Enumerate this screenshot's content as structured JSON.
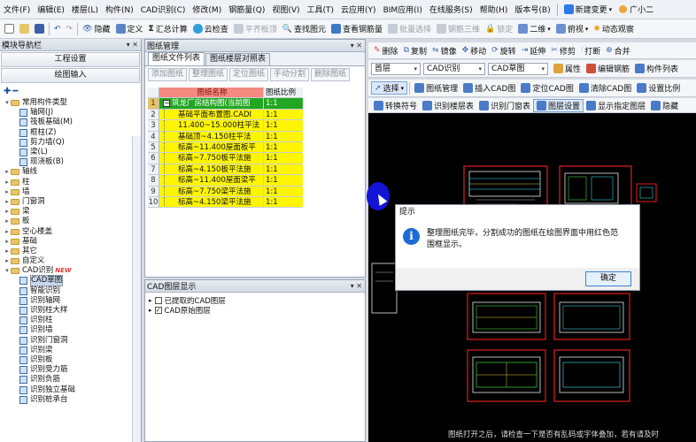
{
  "menubar": {
    "items": [
      "文件(F)",
      "编辑(E)",
      "楼层(L)",
      "构件(N)",
      "CAD识别(C)",
      "修改(M)",
      "钢筋量(Q)",
      "视图(V)",
      "工具(T)",
      "云应用(Y)",
      "BIM应用(I)",
      "在线服务(S)",
      "帮助(H)",
      "版本号(B)"
    ],
    "new_change": "新建变更",
    "user": "广小二"
  },
  "toolbar1": {
    "items": [
      "隐藏",
      "定义",
      "汇总计算",
      "云检查",
      "平齐板顶",
      "查找图元",
      "查看钢筋量",
      "批量选择",
      "钢筋三维",
      "锁定",
      "二维",
      "俯视",
      "动态观察"
    ]
  },
  "left_panel": {
    "title": "模块导航栏",
    "buttons": [
      "工程设置",
      "绘图输入"
    ],
    "tree": [
      {
        "label": "常用构件类型",
        "level": 0,
        "type": "folder",
        "exp": "▾"
      },
      {
        "label": "轴网(J)",
        "level": 1,
        "type": "leaf"
      },
      {
        "label": "筏板基础(M)",
        "level": 1,
        "type": "leaf"
      },
      {
        "label": "框柱(Z)",
        "level": 1,
        "type": "leaf"
      },
      {
        "label": "剪力墙(Q)",
        "level": 1,
        "type": "leaf"
      },
      {
        "label": "梁(L)",
        "level": 1,
        "type": "leaf"
      },
      {
        "label": "现浇板(B)",
        "level": 1,
        "type": "leaf"
      },
      {
        "label": "轴线",
        "level": 0,
        "type": "folder",
        "exp": "▸"
      },
      {
        "label": "柱",
        "level": 0,
        "type": "folder",
        "exp": "▸"
      },
      {
        "label": "墙",
        "level": 0,
        "type": "folder",
        "exp": "▸"
      },
      {
        "label": "门窗洞",
        "level": 0,
        "type": "folder",
        "exp": "▸"
      },
      {
        "label": "梁",
        "level": 0,
        "type": "folder",
        "exp": "▸"
      },
      {
        "label": "板",
        "level": 0,
        "type": "folder",
        "exp": "▸"
      },
      {
        "label": "空心楼盖",
        "level": 0,
        "type": "folder",
        "exp": "▸"
      },
      {
        "label": "基础",
        "level": 0,
        "type": "folder",
        "exp": "▸"
      },
      {
        "label": "其它",
        "level": 0,
        "type": "folder",
        "exp": "▸"
      },
      {
        "label": "自定义",
        "level": 0,
        "type": "folder",
        "exp": "▸"
      },
      {
        "label": "CAD识别",
        "level": 0,
        "type": "folder",
        "exp": "▾",
        "badge": "NEW"
      },
      {
        "label": "CAD草图",
        "level": 1,
        "type": "leaf",
        "selected": true
      },
      {
        "label": "智能识别",
        "level": 1,
        "type": "leaf"
      },
      {
        "label": "识别轴网",
        "level": 1,
        "type": "leaf"
      },
      {
        "label": "识别柱大样",
        "level": 1,
        "type": "leaf"
      },
      {
        "label": "识别柱",
        "level": 1,
        "type": "leaf"
      },
      {
        "label": "识别墙",
        "level": 1,
        "type": "leaf"
      },
      {
        "label": "识别门窗洞",
        "level": 1,
        "type": "leaf"
      },
      {
        "label": "识别梁",
        "level": 1,
        "type": "leaf"
      },
      {
        "label": "识别板",
        "level": 1,
        "type": "leaf"
      },
      {
        "label": "识别受力筋",
        "level": 1,
        "type": "leaf"
      },
      {
        "label": "识别负筋",
        "level": 1,
        "type": "leaf"
      },
      {
        "label": "识别独立基础",
        "level": 1,
        "type": "leaf"
      },
      {
        "label": "识别桩承台",
        "level": 1,
        "type": "leaf"
      }
    ]
  },
  "drawing_panel": {
    "title": "图纸管理",
    "tabs": [
      "图纸文件列表",
      "图纸楼层对照表"
    ],
    "buttons": [
      "添加图纸",
      "整理图纸",
      "定位图纸",
      "手动分割",
      "删除图纸"
    ],
    "columns": [
      "图纸名称",
      "图纸比例"
    ],
    "rows": [
      {
        "num": "1",
        "name": "筑龙厂房结构图(当前图",
        "scale": "1:1",
        "root": true
      },
      {
        "num": "2",
        "name": "基础平面布置图.CADI",
        "scale": "1:1"
      },
      {
        "num": "3",
        "name": "11.400~15.000柱平法",
        "scale": "1:1"
      },
      {
        "num": "4",
        "name": "基础顶~4.150柱平法",
        "scale": "1:1"
      },
      {
        "num": "5",
        "name": "标高~11.400屋面板平",
        "scale": "1:1"
      },
      {
        "num": "6",
        "name": "标高~7.750板平法施",
        "scale": "1:1"
      },
      {
        "num": "7",
        "name": "标高~4.150板平法施",
        "scale": "1:1"
      },
      {
        "num": "8",
        "name": "标高~11.400屋面梁平",
        "scale": "1:1"
      },
      {
        "num": "9",
        "name": "标高~7.750梁平法施",
        "scale": "1:1"
      },
      {
        "num": "10",
        "name": "标高~4.150梁平法施",
        "scale": "1:1"
      }
    ]
  },
  "layer_panel": {
    "title": "CAD图层显示",
    "items": [
      {
        "label": "已提取的CAD图层",
        "checked": false
      },
      {
        "label": "CAD原始图层",
        "checked": true
      }
    ]
  },
  "right_toolbars": {
    "row1": [
      "删除",
      "复制",
      "镜像",
      "移动",
      "旋转",
      "延伸",
      "修剪",
      "打断",
      "合并"
    ],
    "floor": "首层",
    "category": "CAD识别",
    "subcategory": "CAD草图",
    "row2_buttons": [
      "属性",
      "编辑钢筋",
      "构件列表"
    ],
    "select": "选择",
    "row3": [
      "图纸管理",
      "插入CAD图",
      "定位CAD图",
      "清除CAD图",
      "设置比例"
    ],
    "row4": [
      "转换符号",
      "识别楼层表",
      "识别门窗表",
      "图层设置",
      "显示指定图层",
      "隐藏"
    ]
  },
  "dialog": {
    "title": "提示",
    "message": "整理图纸完毕，分割成功的图纸在绘图界面中用红色范围框显示。",
    "ok": "确定"
  },
  "canvas": {
    "status": "图纸打开之后，请检查一下是否有乱码或字体叠加，若有请及时"
  }
}
